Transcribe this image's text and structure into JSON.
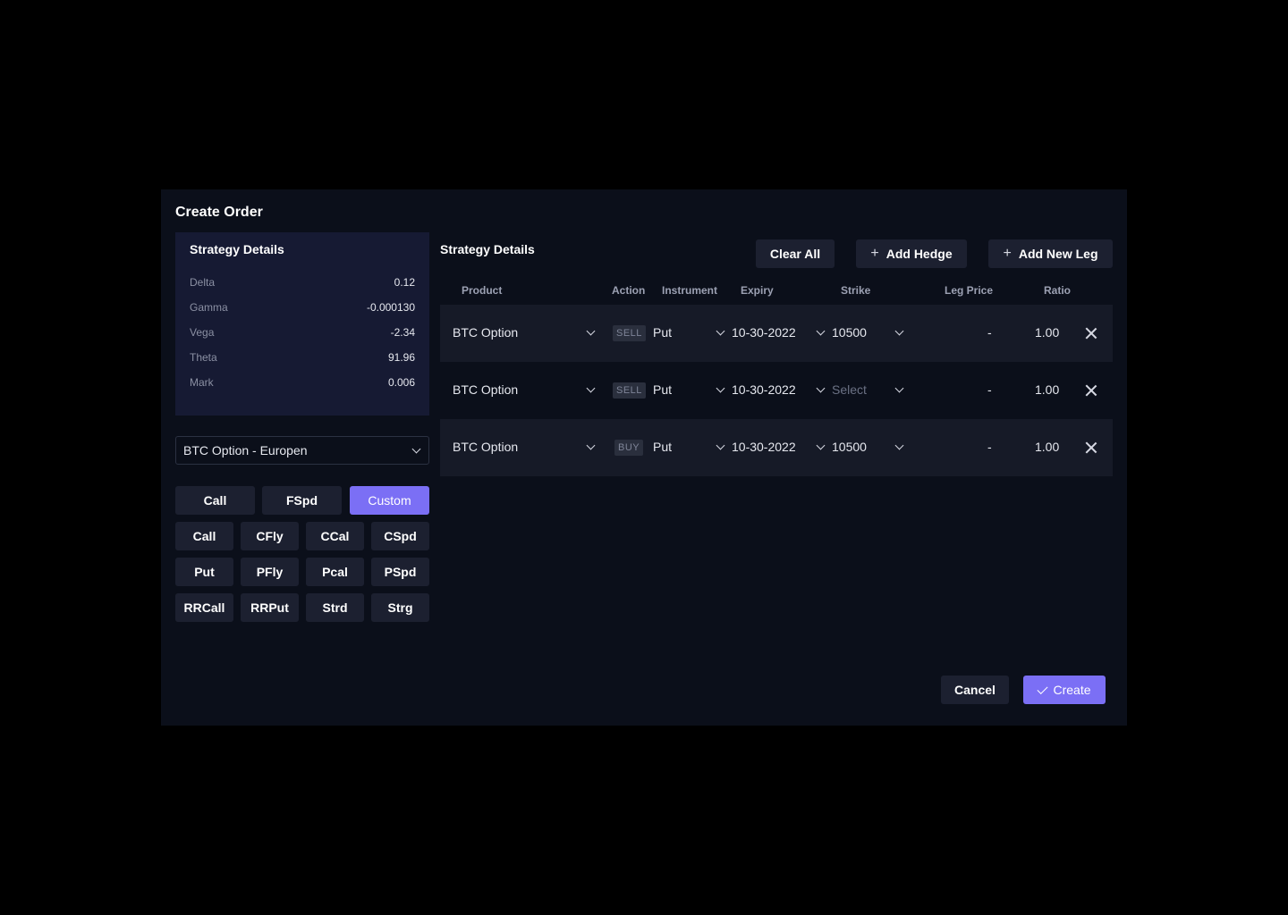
{
  "modal": {
    "title": "Create Order"
  },
  "greeks": {
    "title": "Strategy Details",
    "rows": [
      {
        "label": "Delta",
        "value": "0.12"
      },
      {
        "label": "Gamma",
        "value": "-0.000130"
      },
      {
        "label": "Vega",
        "value": "-2.34"
      },
      {
        "label": "Theta",
        "value": "91.96"
      },
      {
        "label": "Mark",
        "value": "0.006"
      }
    ]
  },
  "product_select": {
    "value": "BTC Option - Europen"
  },
  "strategies": {
    "top": [
      "Call",
      "FSpd",
      "Custom"
    ],
    "active": "Custom",
    "grid": [
      "Call",
      "CFly",
      "CCal",
      "CSpd",
      "Put",
      "PFly",
      "Pcal",
      "PSpd",
      "RRCall",
      "RRPut",
      "Strd",
      "Strg"
    ]
  },
  "right": {
    "title": "Strategy Details",
    "clear_all": "Clear All",
    "add_hedge": "Add Hedge",
    "add_new_leg": "Add New Leg"
  },
  "columns": {
    "product": "Product",
    "action": "Action",
    "instrument": "Instrument",
    "expiry": "Expiry",
    "strike": "Strike",
    "leg_price": "Leg Price",
    "ratio": "Ratio"
  },
  "legs": [
    {
      "product": "BTC Option",
      "action": "SELL",
      "instrument": "Put",
      "expiry": "10-30-2022",
      "strike": "10500",
      "leg_price": "-",
      "ratio": "1.00"
    },
    {
      "product": "BTC Option",
      "action": "SELL",
      "instrument": "Put",
      "expiry": "10-30-2022",
      "strike": "Select",
      "strike_placeholder": true,
      "leg_price": "-",
      "ratio": "1.00"
    },
    {
      "product": "BTC Option",
      "action": "BUY",
      "instrument": "Put",
      "expiry": "10-30-2022",
      "strike": "10500",
      "leg_price": "-",
      "ratio": "1.00"
    }
  ],
  "footer": {
    "cancel": "Cancel",
    "create": "Create"
  },
  "colors": {
    "accent": "#7b6ff5",
    "panel": "#161a33",
    "modal_bg": "#0b0f1a"
  }
}
